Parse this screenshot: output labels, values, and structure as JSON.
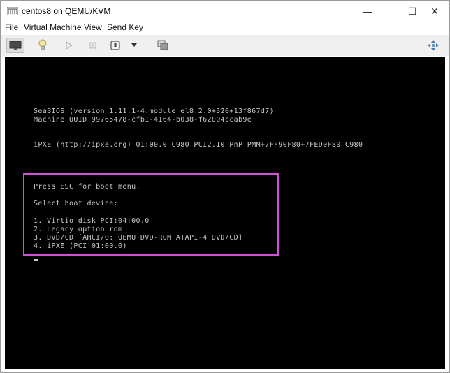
{
  "window": {
    "title": "centos8 on QEMU/KVM",
    "minimize_glyph": "—",
    "maximize_glyph": "☐",
    "close_glyph": "✕"
  },
  "menu": [
    "File",
    "Virtual Machine",
    "View",
    "Send Key"
  ],
  "toolbar": {
    "icons": [
      "monitor-icon",
      "lightbulb-icon",
      "play-icon",
      "pause-icon",
      "power-icon",
      "dropdown-arrow-icon",
      "snapshots-icon",
      "move-icon"
    ]
  },
  "colors": {
    "highlight_border": "#d24fd6",
    "console_bg": "#000000",
    "console_text": "#c8c8c8"
  },
  "console": {
    "bios_line": "SeaBIOS (version 1.11.1-4.module_el8.2.0+320+13f867d7)",
    "uuid_line": "Machine UUID 99765478-cfb1-4164-b038-f62004ccab9e",
    "ipxe_line": "iPXE (http://ipxe.org) 01:00.0 C980 PCI2.10 PnP PMM+7FF90F80+7FED0F80 C980",
    "press_esc": "Press ESC for boot menu.",
    "select_device": "Select boot device:",
    "boot_options": [
      "1. Virtio disk PCI:04:00.0",
      "2. Legacy option rom",
      "3. DVD/CD [AHCI/0: QEMU DVD-ROM ATAPI-4 DVD/CD]",
      "4. iPXE (PCI 01:00.0)"
    ]
  }
}
